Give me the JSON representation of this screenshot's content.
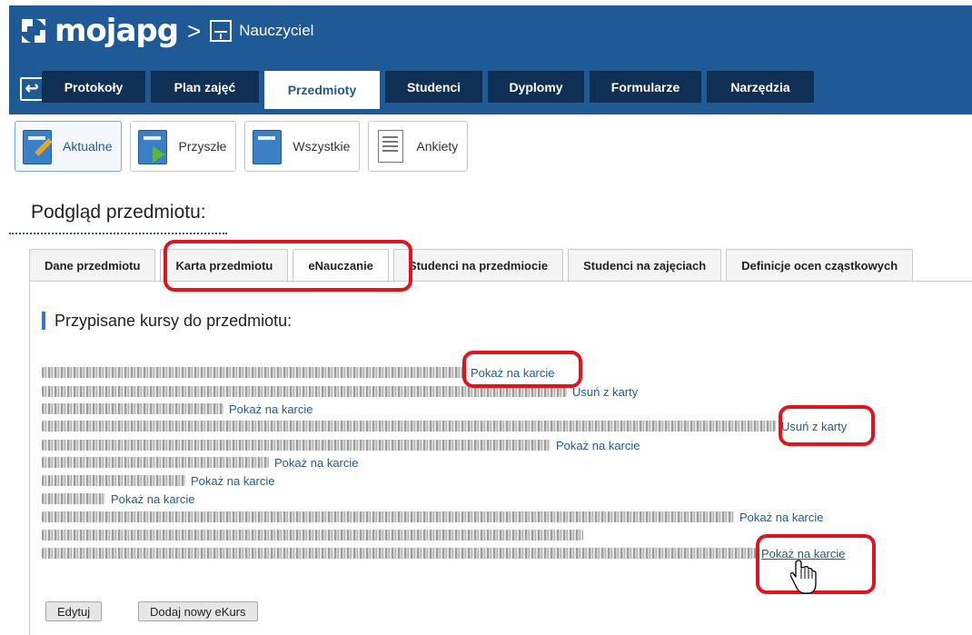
{
  "header": {
    "brand": "mojapg",
    "separator": ">",
    "role": "Nauczyciel",
    "back_icon": "back-arrow-icon"
  },
  "main_tabs": [
    {
      "label": "Protokoły",
      "active": false
    },
    {
      "label": "Plan zajęć",
      "active": false
    },
    {
      "label": "Przedmioty",
      "active": true
    },
    {
      "label": "Studenci",
      "active": false
    },
    {
      "label": "Dyplomy",
      "active": false
    },
    {
      "label": "Formularze",
      "active": false
    },
    {
      "label": "Narzędzia",
      "active": false
    }
  ],
  "sub_nav": [
    {
      "label": "Aktualne",
      "icon": "book-pencil-icon",
      "active": true
    },
    {
      "label": "Przyszłe",
      "icon": "book-arrow-icon",
      "active": false
    },
    {
      "label": "Wszystkie",
      "icon": "book-icon",
      "active": false
    },
    {
      "label": "Ankiety",
      "icon": "form-icon",
      "active": false
    }
  ],
  "page_title": "Podgląd przedmiotu:",
  "inner_tabs": [
    {
      "label": "Dane przedmiotu",
      "active": false
    },
    {
      "label": "Karta przedmiotu",
      "active": false
    },
    {
      "label": "eNauczanie",
      "active": true
    },
    {
      "label": "Studenci na przedmiocie",
      "active": false
    },
    {
      "label": "Studenci na zajęciach",
      "active": false
    },
    {
      "label": "Definicje ocen cząstkowych",
      "active": false
    }
  ],
  "section_heading": "Przypisane kursy do przedmiotu:",
  "courses": [
    {
      "link": "Pokaż na karcie"
    },
    {
      "link": "Usuń z karty"
    },
    {
      "link": "Pokaż na karcie"
    },
    {
      "link": "Usuń z karty"
    },
    {
      "link": "Pokaż na karcie"
    },
    {
      "link": "Pokaż na karcie"
    },
    {
      "link": "Pokaż na karcie"
    },
    {
      "link": "Pokaż na karcie"
    },
    {
      "link": "Pokaż na karcie"
    },
    {
      "link": ""
    },
    {
      "link": "Pokaż na karcie"
    }
  ],
  "buttons": {
    "edit": "Edytuj",
    "add_ecourse": "Dodaj nowy eKurs"
  },
  "colors": {
    "header_blue": "#1f5a96",
    "tab_dark": "#0f2f55",
    "link_blue": "#1f5a96",
    "annotation_red": "#e0141e"
  }
}
